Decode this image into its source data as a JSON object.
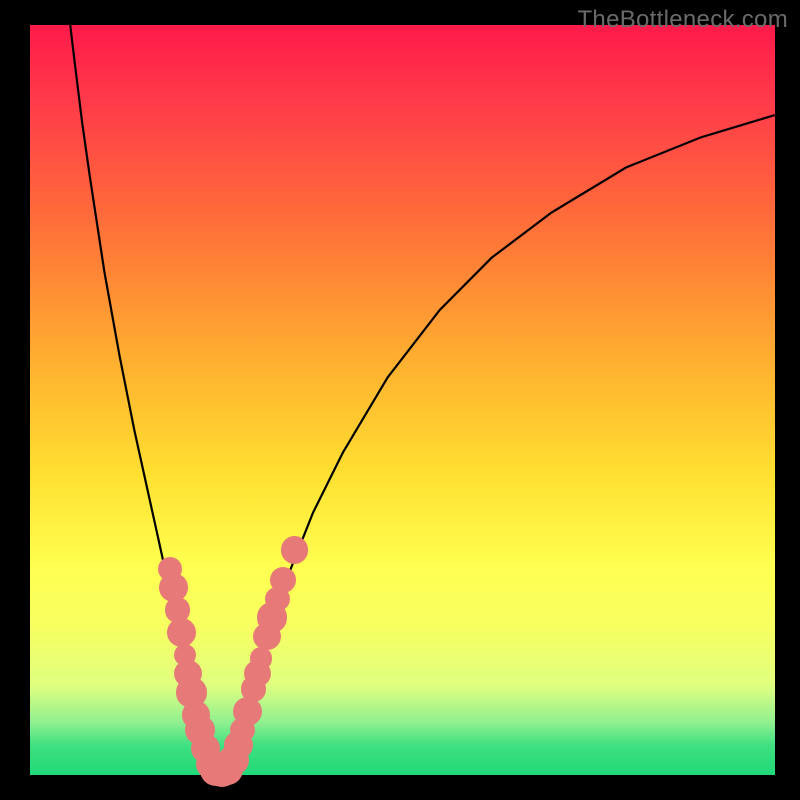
{
  "watermark": "TheBottleneck.com",
  "colors": {
    "background": "#000000",
    "gradient_top": "#ff1a4a",
    "gradient_bottom": "#20d878",
    "curve": "#000000",
    "dots": "#e77a79"
  },
  "chart_data": {
    "type": "line",
    "title": "",
    "xlabel": "",
    "ylabel": "",
    "xlim": [
      0,
      100
    ],
    "ylim": [
      0,
      100
    ],
    "curve": {
      "description": "V-shaped bottleneck curve; minimum near x≈25",
      "points": [
        {
          "x": 5.4,
          "y": 100
        },
        {
          "x": 6.0,
          "y": 95
        },
        {
          "x": 7.0,
          "y": 87
        },
        {
          "x": 8.0,
          "y": 80
        },
        {
          "x": 10.0,
          "y": 67
        },
        {
          "x": 12.0,
          "y": 56
        },
        {
          "x": 14.0,
          "y": 46
        },
        {
          "x": 16.0,
          "y": 37
        },
        {
          "x": 18.0,
          "y": 28
        },
        {
          "x": 20.0,
          "y": 18
        },
        {
          "x": 22.0,
          "y": 10
        },
        {
          "x": 24.0,
          "y": 3
        },
        {
          "x": 25.5,
          "y": 0.5
        },
        {
          "x": 27.0,
          "y": 2
        },
        {
          "x": 29.0,
          "y": 8
        },
        {
          "x": 31.0,
          "y": 15
        },
        {
          "x": 34.0,
          "y": 25
        },
        {
          "x": 38.0,
          "y": 35
        },
        {
          "x": 42.0,
          "y": 43
        },
        {
          "x": 48.0,
          "y": 53
        },
        {
          "x": 55.0,
          "y": 62
        },
        {
          "x": 62.0,
          "y": 69
        },
        {
          "x": 70.0,
          "y": 75
        },
        {
          "x": 80.0,
          "y": 81
        },
        {
          "x": 90.0,
          "y": 85
        },
        {
          "x": 100.0,
          "y": 88
        }
      ]
    },
    "dots": [
      {
        "x": 18.8,
        "y": 27.5,
        "r": 1.1
      },
      {
        "x": 19.3,
        "y": 25.0,
        "r": 1.4
      },
      {
        "x": 19.8,
        "y": 22.0,
        "r": 1.2
      },
      {
        "x": 20.3,
        "y": 19.0,
        "r": 1.4
      },
      {
        "x": 20.8,
        "y": 16.0,
        "r": 1.0
      },
      {
        "x": 21.2,
        "y": 13.5,
        "r": 1.3
      },
      {
        "x": 21.7,
        "y": 11.0,
        "r": 1.5
      },
      {
        "x": 22.3,
        "y": 8.0,
        "r": 1.3
      },
      {
        "x": 22.8,
        "y": 6.0,
        "r": 1.5
      },
      {
        "x": 23.5,
        "y": 3.5,
        "r": 1.4
      },
      {
        "x": 24.3,
        "y": 1.5,
        "r": 1.5
      },
      {
        "x": 25.0,
        "y": 0.7,
        "r": 1.6
      },
      {
        "x": 25.8,
        "y": 0.5,
        "r": 1.6
      },
      {
        "x": 26.5,
        "y": 0.8,
        "r": 1.6
      },
      {
        "x": 27.3,
        "y": 2.0,
        "r": 1.5
      },
      {
        "x": 28.0,
        "y": 4.0,
        "r": 1.4
      },
      {
        "x": 28.5,
        "y": 6.0,
        "r": 1.1
      },
      {
        "x": 29.2,
        "y": 8.5,
        "r": 1.4
      },
      {
        "x": 30.0,
        "y": 11.5,
        "r": 1.2
      },
      {
        "x": 30.5,
        "y": 13.5,
        "r": 1.3
      },
      {
        "x": 31.0,
        "y": 15.5,
        "r": 1.0
      },
      {
        "x": 31.8,
        "y": 18.5,
        "r": 1.3
      },
      {
        "x": 32.5,
        "y": 21.0,
        "r": 1.5
      },
      {
        "x": 33.2,
        "y": 23.5,
        "r": 1.1
      },
      {
        "x": 34.0,
        "y": 26.0,
        "r": 1.2
      },
      {
        "x": 35.5,
        "y": 30.0,
        "r": 1.3
      }
    ]
  }
}
